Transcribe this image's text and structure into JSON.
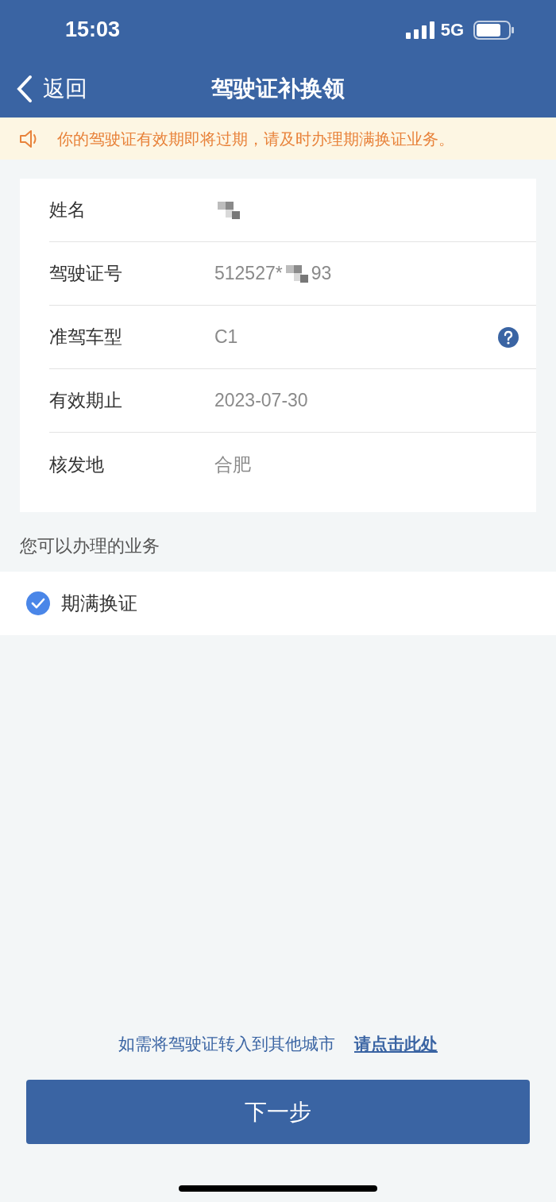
{
  "status_bar": {
    "time": "15:03",
    "network": "5G"
  },
  "nav": {
    "back_label": "返回",
    "title": "驾驶证补换领"
  },
  "notice": {
    "text": "你的驾驶证有效期即将过期，请及时办理期满换证业务。"
  },
  "fields": [
    {
      "label": "姓名",
      "redacted": true,
      "help": false
    },
    {
      "label": "驾驶证号",
      "value_parts": [
        "512527*",
        "93"
      ],
      "redacted": true,
      "help": false
    },
    {
      "label": "准驾车型",
      "value_parts": [
        "C1"
      ],
      "redacted": false,
      "help": true
    },
    {
      "label": "有效期止",
      "value_parts": [
        "2023-07-30"
      ],
      "redacted": false,
      "help": false
    },
    {
      "label": "核发地",
      "value_parts": [
        "合肥"
      ],
      "redacted": false,
      "help": false
    }
  ],
  "services_title": "您可以办理的业务",
  "services": [
    {
      "label": "期满换证",
      "checked": true
    }
  ],
  "footer": {
    "transfer_text": "如需将驾驶证转入到其他城市",
    "transfer_link": "请点击此处",
    "next_button": "下一步"
  }
}
